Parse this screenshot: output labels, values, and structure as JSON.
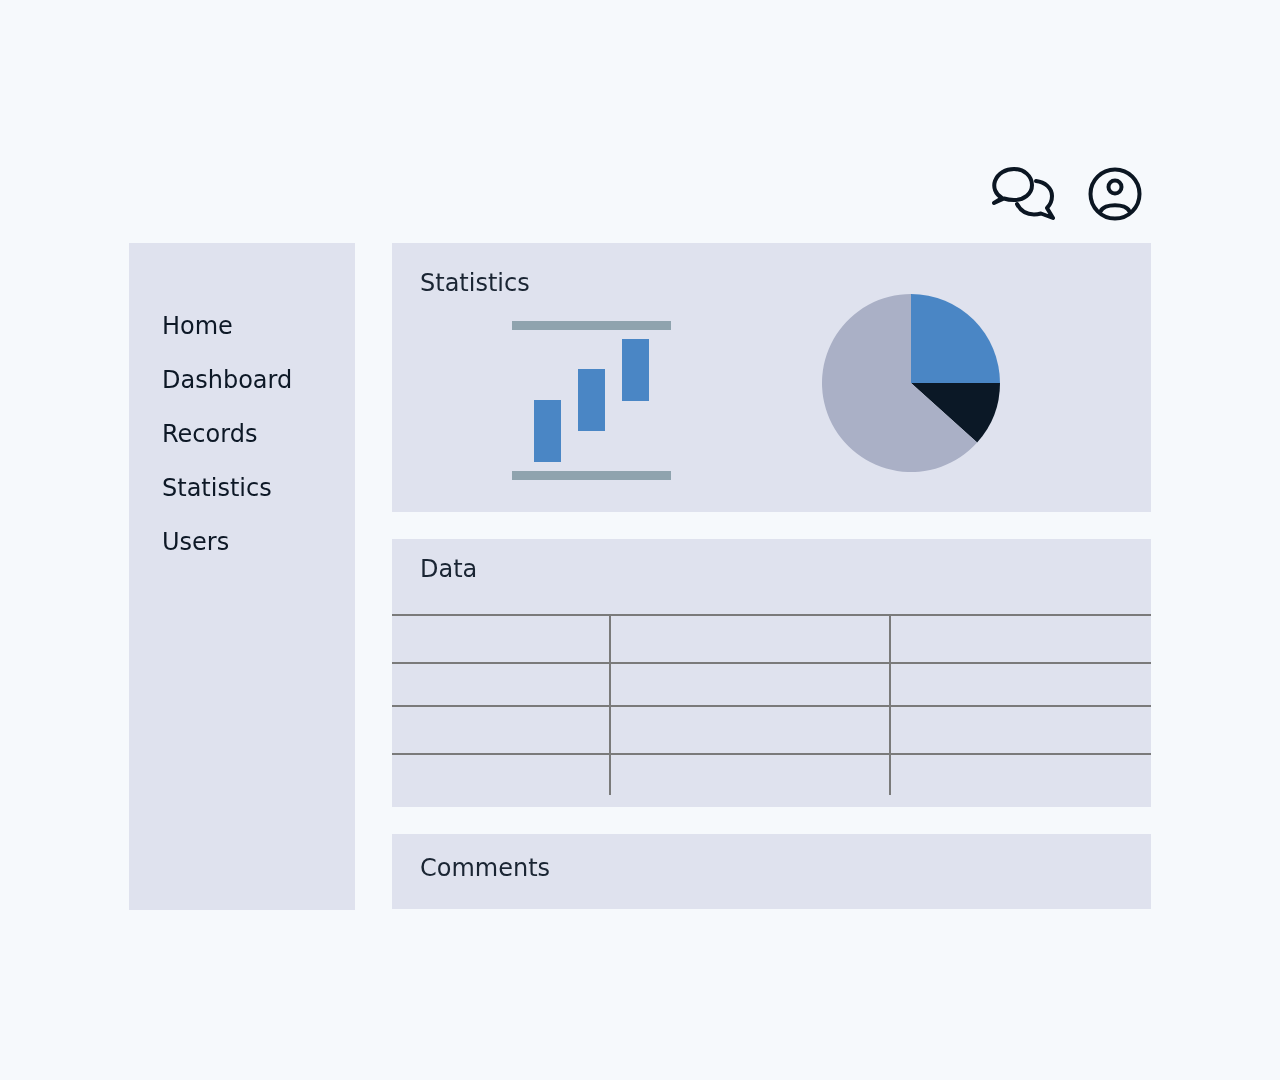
{
  "sidebar": {
    "items": [
      {
        "label": "Home",
        "selected": false
      },
      {
        "label": "Dashboard",
        "selected": false
      },
      {
        "label": "Records",
        "selected": false
      },
      {
        "label": "Statistics",
        "selected": false
      },
      {
        "label": "Users",
        "selected": false
      }
    ]
  },
  "panels": [
    {
      "kind": "statistics",
      "title": "Statistics"
    },
    {
      "kind": "table",
      "title": "Data"
    },
    {
      "kind": "comments",
      "title": "Comments"
    }
  ]
}
